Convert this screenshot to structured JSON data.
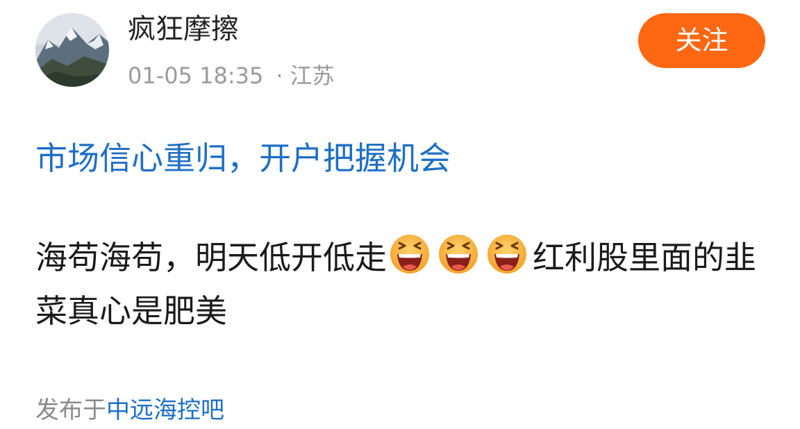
{
  "post": {
    "author": {
      "name": "疯狂摩擦",
      "avatar_icon": "avatar-mountain-image"
    },
    "time": "01-05 18:35",
    "separator": "·",
    "location": "江苏",
    "follow_label": "关注",
    "topic_link": "市场信心重归，开户把握机会",
    "body": {
      "segment_1": "海苟海苟，明天低开低走",
      "emoji_icon": "laughing-face-icon",
      "emoji_count": 3,
      "segment_2": "红利股里面的韭菜真心是肥美"
    },
    "footer": {
      "prefix": "发布于",
      "forum_link": "中远海控吧"
    }
  },
  "colors": {
    "accent": "#ff6813",
    "link": "#1e6fc4",
    "text": "#1a1a1a",
    "muted": "#9a9a9a"
  }
}
